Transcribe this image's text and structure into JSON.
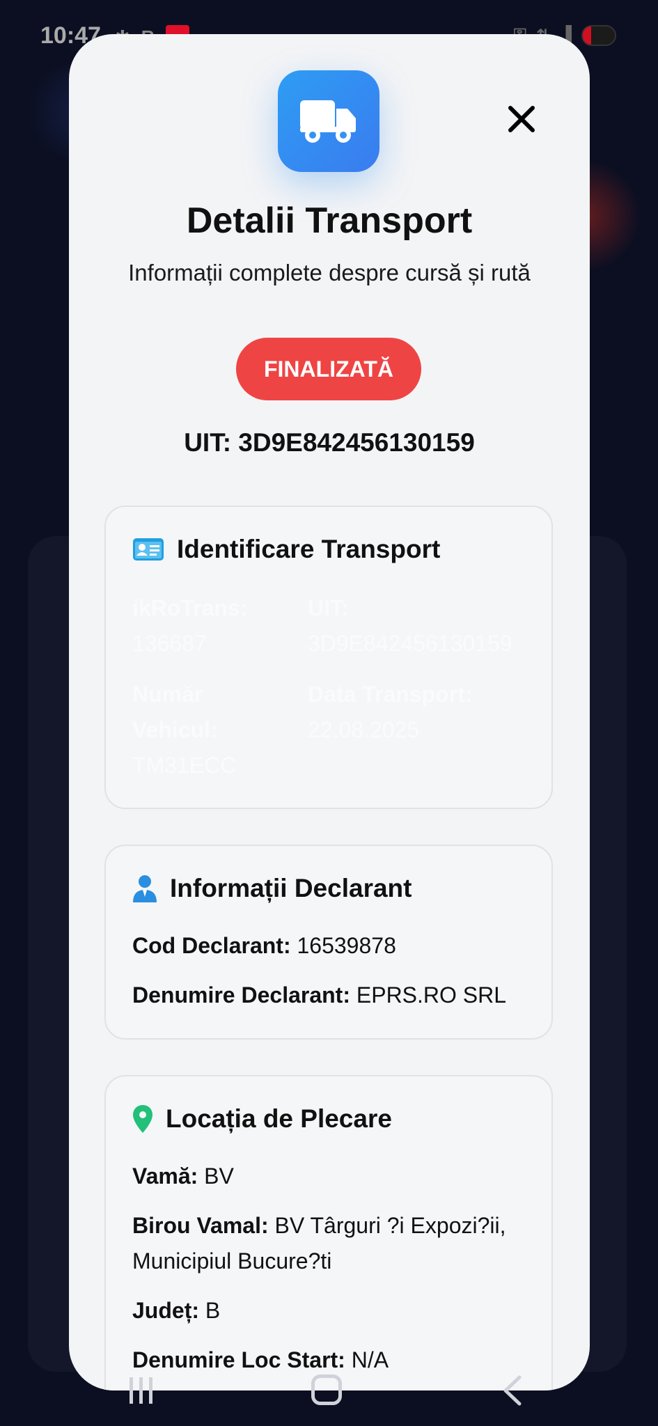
{
  "status_bar": {
    "time": "10:47",
    "left_icons": [
      "bluetooth-icon",
      "r-icon",
      "app-badge-icon",
      "dot-icon"
    ],
    "right_icons": [
      "key-icon",
      "data-icon",
      "signal-icon",
      "battery-icon"
    ],
    "battery": "27"
  },
  "modal": {
    "title": "Detalii Transport",
    "subtitle": "Informații complete despre cursă și rută",
    "status": "FINALIZATĂ",
    "uit_line": "UIT: 3D9E842456130159",
    "colors": {
      "accent": "#3a8ef3",
      "status": "#ef4444",
      "card_bg": "#f5f6f8"
    }
  },
  "identification": {
    "heading": "Identificare Transport",
    "fields": [
      {
        "label": "ikRoTrans:",
        "value": "136687"
      },
      {
        "label": "UIT:",
        "value": "3D9E842456130159"
      },
      {
        "label": "Număr Vehicul:",
        "value": "TM31ECC"
      },
      {
        "label": "Data Transport:",
        "value": "22.08.2025"
      }
    ]
  },
  "declarant": {
    "heading": "Informații Declarant",
    "fields": [
      {
        "label": "Cod Declarant:",
        "value": "16539878"
      },
      {
        "label": "Denumire Declarant:",
        "value": "EPRS.RO SRL"
      }
    ]
  },
  "departure": {
    "heading": "Locația de Plecare",
    "fields": [
      {
        "label": "Vamă:",
        "value": "BV"
      },
      {
        "label": "Birou Vamal:",
        "value": "BV Târguri ?i Expozi?ii, Municipiul Bucure?ti"
      },
      {
        "label": "Județ:",
        "value": "B"
      },
      {
        "label": "Denumire Loc Start:",
        "value": "N/A"
      }
    ]
  }
}
